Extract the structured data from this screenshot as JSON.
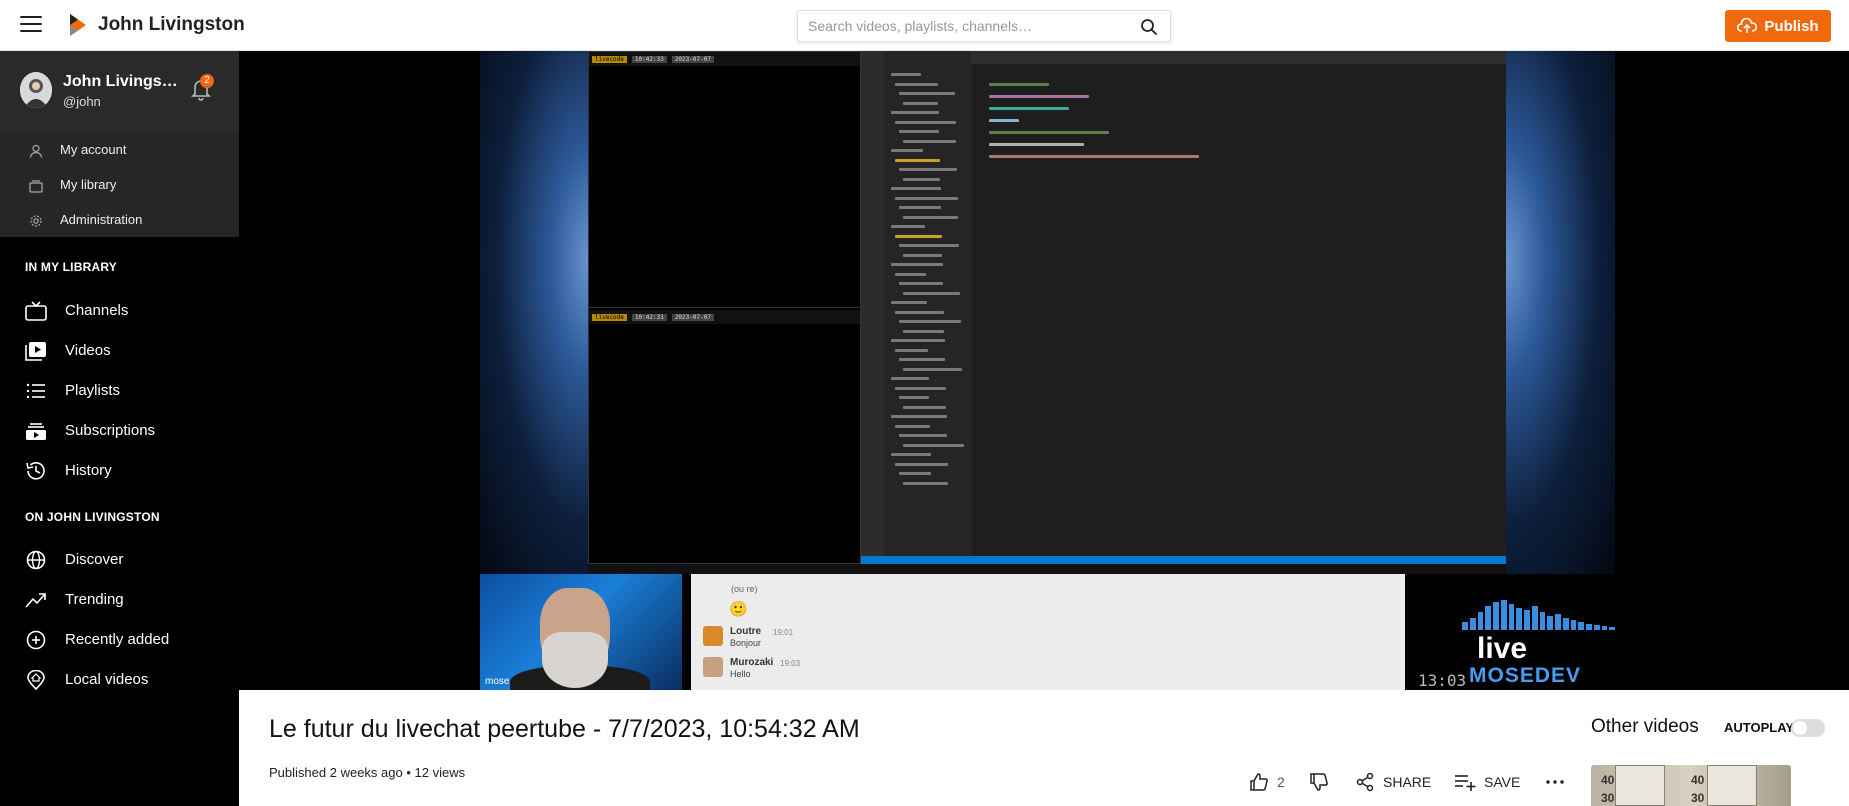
{
  "header": {
    "brand": "John Livingston",
    "search_placeholder": "Search videos, playlists, channels…",
    "publish_label": "Publish",
    "accent_color": "#f1680d"
  },
  "sidebar": {
    "user": {
      "name": "John Livings…",
      "handle": "@john",
      "notifications": "2"
    },
    "user_menu": [
      {
        "label": "My account",
        "icon": "user-icon"
      },
      {
        "label": "My library",
        "icon": "library-icon"
      },
      {
        "label": "Administration",
        "icon": "cog-icon"
      }
    ],
    "library_title": "IN MY LIBRARY",
    "library_items": [
      {
        "label": "Channels",
        "icon": "channels-icon"
      },
      {
        "label": "Videos",
        "icon": "videos-icon"
      },
      {
        "label": "Playlists",
        "icon": "playlists-icon"
      },
      {
        "label": "Subscriptions",
        "icon": "subscriptions-icon"
      },
      {
        "label": "History",
        "icon": "history-icon"
      }
    ],
    "instance_title": "ON JOHN LIVINGSTON",
    "instance_items": [
      {
        "label": "Discover",
        "icon": "globe-icon"
      },
      {
        "label": "Trending",
        "icon": "trending-icon"
      },
      {
        "label": "Recently added",
        "icon": "plus-circle-icon"
      },
      {
        "label": "Local videos",
        "icon": "home-pin-icon"
      }
    ]
  },
  "player": {
    "cam_tag": "mose",
    "chat": {
      "top_text": "(ou re)",
      "emoji": "🙂",
      "messages": [
        {
          "user": "Loutre",
          "time": "19:01",
          "text": "Bonjour"
        },
        {
          "user": "Murozaki",
          "time": "19:03",
          "text": "Hello"
        }
      ]
    },
    "overlay": {
      "time": "13:03",
      "live_text": "live",
      "brand_text": "MOSEDEV"
    }
  },
  "video": {
    "title": "Le futur du livechat peertube - 7/7/2023, 10:54:32 AM",
    "published": "Published",
    "published_when": "2 weeks ago",
    "views": "• 12 views",
    "likes": "2",
    "share_label": "SHARE",
    "save_label": "SAVE"
  },
  "recommendations": {
    "title": "Other videos",
    "autoplay_label": "AUTOPLAY",
    "autoplay_on": false,
    "thumb_numbers": [
      "40",
      "30",
      "40",
      "30"
    ]
  }
}
